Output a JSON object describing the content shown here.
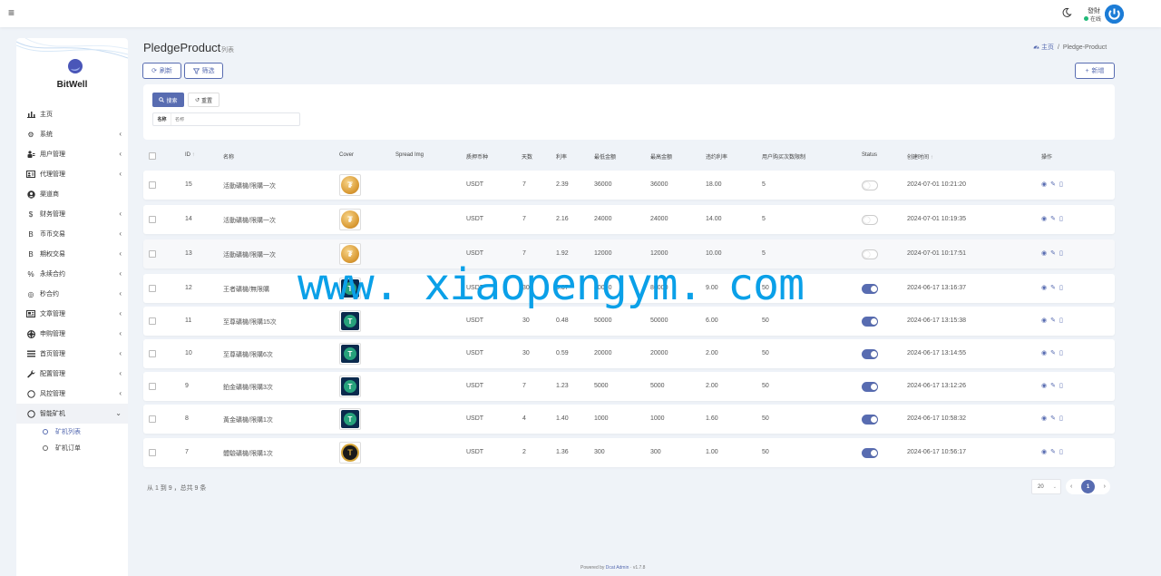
{
  "topbar": {
    "user_name": "發財",
    "status": "在线"
  },
  "sidebar": {
    "brand": "BitWell",
    "items": [
      {
        "label": "主页",
        "icon": "bar-chart-icon",
        "chev": ""
      },
      {
        "label": "系统",
        "icon": "gear-icon",
        "chev": "‹"
      },
      {
        "label": "用户管理",
        "icon": "user-group-icon",
        "chev": "‹"
      },
      {
        "label": "代理管理",
        "icon": "id-card-icon",
        "chev": "‹"
      },
      {
        "label": "渠道商",
        "icon": "user-circle-icon",
        "chev": ""
      },
      {
        "label": "财务管理",
        "icon": "dollar-icon",
        "chev": "‹"
      },
      {
        "label": "币币交易",
        "icon": "bitcoin-icon",
        "chev": "‹"
      },
      {
        "label": "期权交易",
        "icon": "bitcoin-icon",
        "chev": "‹"
      },
      {
        "label": "永续合约",
        "icon": "link-icon",
        "chev": "‹"
      },
      {
        "label": "秒合约",
        "icon": "target-icon",
        "chev": "‹"
      },
      {
        "label": "文章管理",
        "icon": "newspaper-icon",
        "chev": "‹"
      },
      {
        "label": "申购管理",
        "icon": "life-ring-icon",
        "chev": "‹"
      },
      {
        "label": "首页管理",
        "icon": "list-icon",
        "chev": "‹"
      },
      {
        "label": "配置管理",
        "icon": "wrench-icon",
        "chev": "‹"
      },
      {
        "label": "风控管理",
        "icon": "circle-icon",
        "chev": "‹"
      },
      {
        "label": "智能矿机",
        "icon": "circle-icon",
        "chev": "⌄"
      }
    ],
    "sub_items": [
      {
        "label": "矿机列表",
        "active": true
      },
      {
        "label": "矿机订单",
        "active": false
      }
    ]
  },
  "header": {
    "title": "PledgeProduct",
    "subtitle": "列表",
    "breadcrumb_home": "主页",
    "breadcrumb_sep": "/",
    "breadcrumb_current": "Pledge-Product",
    "refresh_label": "刷新",
    "filter_label": "筛选",
    "new_label": "新增"
  },
  "filter": {
    "search_label": "搜索",
    "reset_label": "重置",
    "field_label": "名称",
    "field_placeholder": "名称"
  },
  "table": {
    "columns": [
      "ID",
      "名称",
      "Cover",
      "Spread Img",
      "质押币种",
      "天数",
      "利率",
      "最低金额",
      "最高金额",
      "违约利率",
      "用户购买次数限制",
      "Status",
      "创建时间",
      "操作"
    ],
    "rows": [
      {
        "id": "15",
        "name": "活動礦機/限購一次",
        "cover": "gold",
        "currency": "USDT",
        "days": "7",
        "rate": "2.39",
        "min": "36000",
        "max": "36000",
        "penalty": "18.00",
        "limit": "5",
        "status": false,
        "created": "2024-07-01 10:21:20"
      },
      {
        "id": "14",
        "name": "活動礦機/限購一次",
        "cover": "gold",
        "currency": "USDT",
        "days": "7",
        "rate": "2.16",
        "min": "24000",
        "max": "24000",
        "penalty": "14.00",
        "limit": "5",
        "status": false,
        "created": "2024-07-01 10:19:35"
      },
      {
        "id": "13",
        "name": "活動礦機/限購一次",
        "cover": "gold",
        "currency": "USDT",
        "days": "7",
        "rate": "1.92",
        "min": "12000",
        "max": "12000",
        "penalty": "10.00",
        "limit": "5",
        "status": false,
        "created": "2024-07-01 10:17:51"
      },
      {
        "id": "12",
        "name": "王者礦機/無限購",
        "cover": "tether",
        "currency": "USDT",
        "days": "30",
        "rate": "0.37",
        "min": "80000",
        "max": "80000",
        "penalty": "9.00",
        "limit": "50",
        "status": true,
        "created": "2024-06-17 13:16:37"
      },
      {
        "id": "11",
        "name": "至尊礦機/限購15次",
        "cover": "tether",
        "currency": "USDT",
        "days": "30",
        "rate": "0.48",
        "min": "50000",
        "max": "50000",
        "penalty": "6.00",
        "limit": "50",
        "status": true,
        "created": "2024-06-17 13:15:38"
      },
      {
        "id": "10",
        "name": "至尊礦機/限購6次",
        "cover": "tether",
        "currency": "USDT",
        "days": "30",
        "rate": "0.59",
        "min": "20000",
        "max": "20000",
        "penalty": "2.00",
        "limit": "50",
        "status": true,
        "created": "2024-06-17 13:14:55"
      },
      {
        "id": "9",
        "name": "鉑金礦機/限購3次",
        "cover": "tether",
        "currency": "USDT",
        "days": "7",
        "rate": "1.23",
        "min": "5000",
        "max": "5000",
        "penalty": "2.00",
        "limit": "50",
        "status": true,
        "created": "2024-06-17 13:12:26"
      },
      {
        "id": "8",
        "name": "黃金礦機/限購1次",
        "cover": "tether",
        "currency": "USDT",
        "days": "4",
        "rate": "1.40",
        "min": "1000",
        "max": "1000",
        "penalty": "1.60",
        "limit": "50",
        "status": true,
        "created": "2024-06-17 10:58:32"
      },
      {
        "id": "7",
        "name": "體驗礦機/限購1次",
        "cover": "black",
        "currency": "USDT",
        "days": "2",
        "rate": "1.36",
        "min": "300",
        "max": "300",
        "penalty": "1.00",
        "limit": "50",
        "status": true,
        "created": "2024-06-17 10:56:17"
      }
    ]
  },
  "pagination": {
    "summary": "从 1 到 9 ，总共 9 条",
    "page_size": "20",
    "current_page": "1",
    "prev": "‹",
    "next": "›"
  },
  "footer": {
    "prefix": "Powered by",
    "brand": "Dcat Admin",
    "version": "· v1.7.8"
  },
  "watermark": "www. xiaopengym. com",
  "colors": {
    "primary": "#586cb1",
    "background": "#eff3f8",
    "online": "#21b978",
    "watermark": "#0aa0e8"
  }
}
